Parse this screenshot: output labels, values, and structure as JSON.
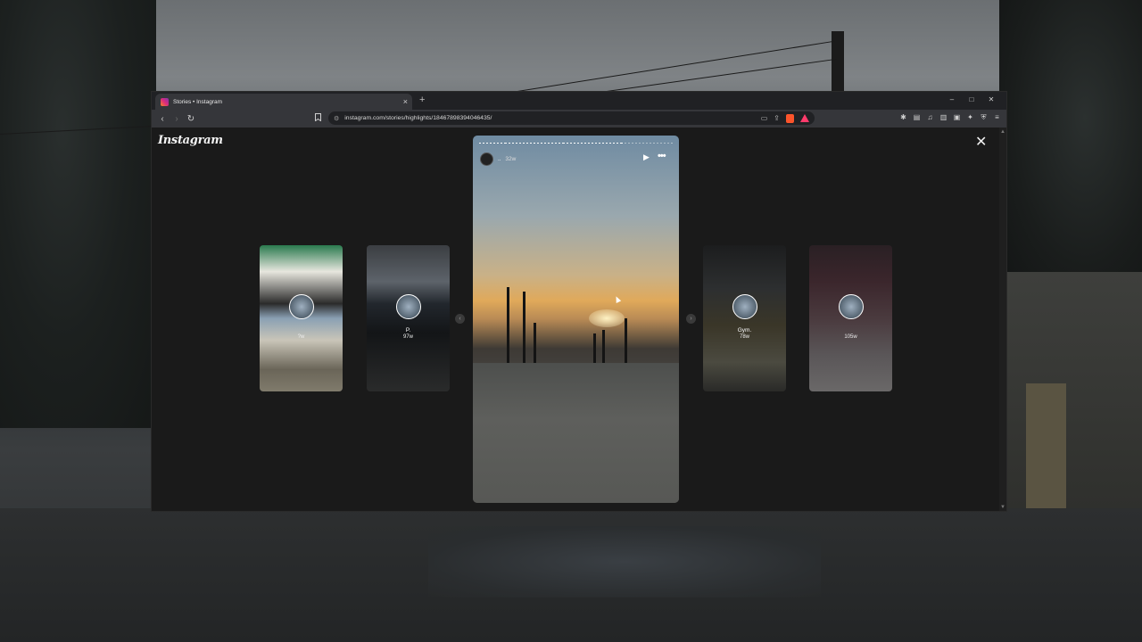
{
  "browser": {
    "tab_title": "Stories • Instagram",
    "tab_close": "×",
    "new_tab": "+",
    "window_controls": {
      "minimize": "–",
      "maximize": "□",
      "close": "✕"
    },
    "url": "instagram.com/stories/highlights/18467898394046435/"
  },
  "page": {
    "logo": "Instagram",
    "close": "✕"
  },
  "story": {
    "username": "..",
    "time": "32w",
    "play_icon": "▶",
    "more_icon": "•••"
  },
  "thumbnails": [
    {
      "name": "",
      "time": "?w"
    },
    {
      "name": "P.",
      "time": "97w"
    },
    {
      "name": "Gym.",
      "time": "78w"
    },
    {
      "name": "",
      "time": "105w"
    }
  ],
  "icons": {
    "back": "‹",
    "forward": "›",
    "reload": "↻",
    "bookmark": "🔖",
    "prev": "‹",
    "next": "›"
  }
}
